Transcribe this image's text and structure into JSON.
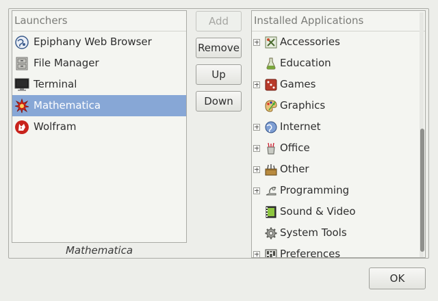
{
  "launchers": {
    "header": "Launchers",
    "items": [
      {
        "label": "Epiphany Web Browser",
        "icon": "globe-icon",
        "selected": false
      },
      {
        "label": "File Manager",
        "icon": "file-cabinet-icon",
        "selected": false
      },
      {
        "label": "Terminal",
        "icon": "monitor-icon",
        "selected": false
      },
      {
        "label": "Mathematica",
        "icon": "mathematica-star-icon",
        "selected": true
      },
      {
        "label": "Wolfram",
        "icon": "wolfram-wolf-icon",
        "selected": false
      }
    ],
    "selected_caption": "Mathematica"
  },
  "buttons": {
    "add": "Add",
    "remove": "Remove",
    "up": "Up",
    "down": "Down",
    "ok": "OK"
  },
  "installed": {
    "header": "Installed Applications",
    "items": [
      {
        "label": "Accessories",
        "icon": "accessories-icon",
        "expandable": true
      },
      {
        "label": "Education",
        "icon": "education-icon",
        "expandable": false
      },
      {
        "label": "Games",
        "icon": "games-icon",
        "expandable": true
      },
      {
        "label": "Graphics",
        "icon": "graphics-palette-icon",
        "expandable": false
      },
      {
        "label": "Internet",
        "icon": "internet-globe-icon",
        "expandable": true
      },
      {
        "label": "Office",
        "icon": "office-icon",
        "expandable": true
      },
      {
        "label": "Other",
        "icon": "other-icon",
        "expandable": true
      },
      {
        "label": "Programming",
        "icon": "programming-icon",
        "expandable": true
      },
      {
        "label": "Sound & Video",
        "icon": "sound-video-icon",
        "expandable": false
      },
      {
        "label": "System Tools",
        "icon": "gear-icon",
        "expandable": false
      },
      {
        "label": "Preferences",
        "icon": "preferences-icon",
        "expandable": true
      }
    ]
  },
  "colors": {
    "selection": "#87a7d6",
    "background": "#edeeea"
  }
}
